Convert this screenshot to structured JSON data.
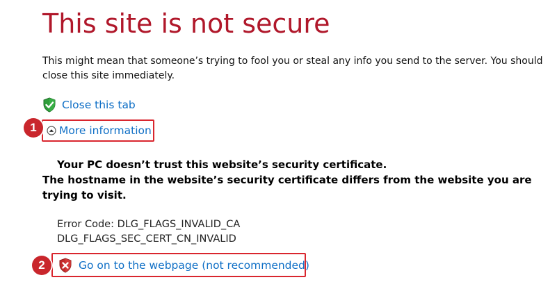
{
  "title": "This site is not secure",
  "description": "This might mean that someone’s trying to fool you or steal any info you send to the server. You should close this site immediately.",
  "close_tab_label": "Close this tab",
  "more_info_label": "More information",
  "callouts": [
    "1",
    "2"
  ],
  "cert_untrusted": "Your PC doesn’t trust this website’s security certificate.",
  "hostname_mismatch": "The hostname in the website’s security certificate differs from the website you are trying to visit.",
  "error_code_line1": "Error Code: DLG_FLAGS_INVALID_CA",
  "error_code_line2": "DLG_FLAGS_SEC_CERT_CN_INVALID",
  "go_on_label": "Go on to the webpage (not recommended)",
  "colors": {
    "title": "#b0172a",
    "link": "#0f6fc6",
    "highlight": "#d9262e",
    "shield_green": "#2e9d3a",
    "shield_red": "#c42b2b"
  },
  "icons": {
    "close_tab": "green-shield-check-icon",
    "more_info": "chevron-up-circle-icon",
    "go_on": "red-shield-x-icon"
  }
}
